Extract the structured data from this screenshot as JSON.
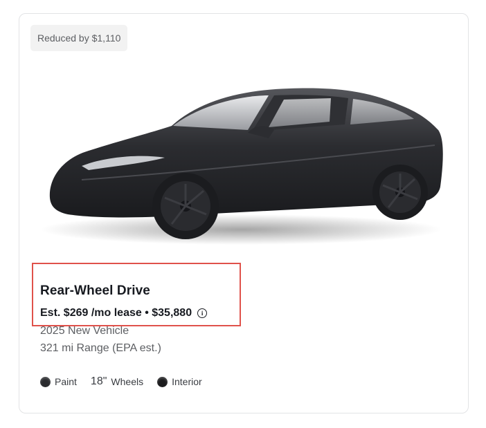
{
  "badge": {
    "text": "Reduced by $1,110"
  },
  "vehicle": {
    "image_alt": "Car image",
    "title": "Rear-Wheel Drive",
    "price_line": "Est. $269 /mo lease • $35,880",
    "info_icon": "info-icon",
    "year_condition": "2025 New Vehicle",
    "range": "321 mi Range (EPA est.)"
  },
  "options": {
    "paint_label": "Paint",
    "wheels_size": "18\"",
    "wheels_label": "Wheels",
    "interior_label": "Interior"
  },
  "colors": {
    "highlight_border": "#e0514a",
    "card_border": "#e2e3e5",
    "text_primary": "#171a20",
    "text_secondary": "#5c5e62"
  }
}
